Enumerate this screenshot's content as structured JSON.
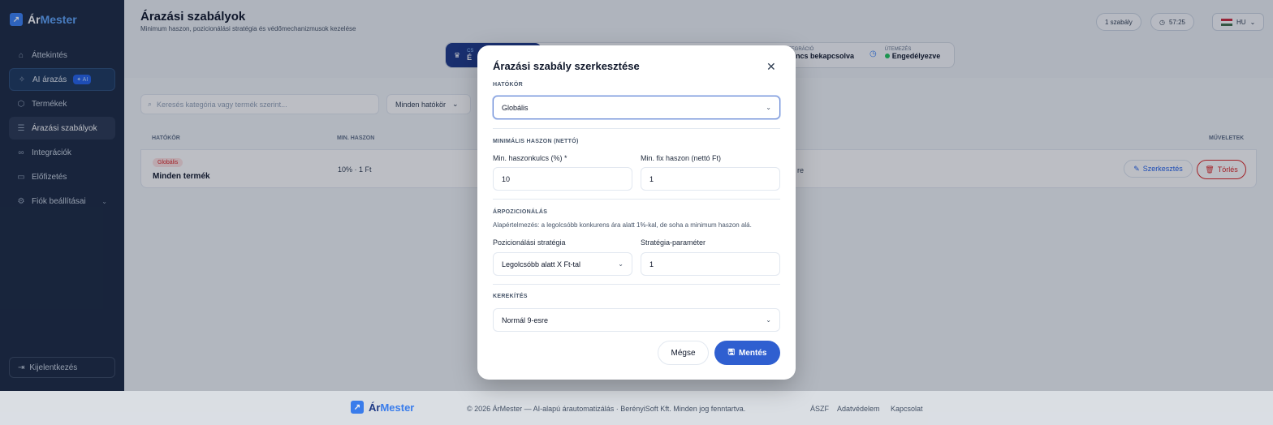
{
  "app": {
    "logo_prefix": "Ár",
    "logo_suffix": "Mester"
  },
  "sidebar": {
    "items": [
      {
        "label": "Áttekintés",
        "icon": "home-icon"
      },
      {
        "label": "AI árazás",
        "icon": "sparkle-icon",
        "badge": "✦ AI"
      },
      {
        "label": "Termékek",
        "icon": "box-icon"
      },
      {
        "label": "Árazási szabályok",
        "icon": "sliders-icon"
      },
      {
        "label": "Integrációk",
        "icon": "link-icon"
      },
      {
        "label": "Előfizetés",
        "icon": "card-icon"
      },
      {
        "label": "Fiók beállításai",
        "icon": "gear-icon"
      }
    ],
    "logout": "Kijelentkezés"
  },
  "header": {
    "title": "Árazási szabályok",
    "subtitle": "Minimum haszon, pozicionálási stratégia és védőmechanizmusok kezelése",
    "rule_count": "1 szabály",
    "timer": "57:25",
    "language": "HU"
  },
  "status": {
    "plan_small": "CS",
    "plan_big": "É",
    "integration_label": "TEGRÁCIÓ",
    "integration_value": "Nincs bekapcsolva",
    "schedule_label": "ÜTEMEZÉS",
    "schedule_value": "Engedélyezve"
  },
  "filters": {
    "search_placeholder": "Keresés kategória vagy termék szerint...",
    "scope": "Minden hatókör"
  },
  "table": {
    "headers": {
      "scope": "HATÓKÖR",
      "margin": "MIN. HASZON",
      "actions": "MŰVELETEK"
    },
    "row": {
      "badge": "Globális",
      "name": "Minden termék",
      "margin": "10% · 1 Ft",
      "rounding_tail": "re",
      "edit": "Szerkesztés",
      "delete": "Törlés"
    }
  },
  "modal": {
    "title": "Árazási szabály szerkesztése",
    "scope_label": "HATÓKÖR",
    "scope_value": "Globális",
    "margin_section": "MINIMÁLIS HASZON (NETTÓ)",
    "margin_pct_label": "Min. haszonkulcs (%) *",
    "margin_pct_value": "10",
    "margin_fix_label": "Min. fix haszon (nettó Ft)",
    "margin_fix_value": "1",
    "pos_section": "ÁRPOZICIONÁLÁS",
    "pos_hint": "Alapértelmezés: a legolcsóbb konkurens ára alatt 1%-kal, de soha a minimum haszon alá.",
    "strategy_label": "Pozicionálási stratégia",
    "strategy_value": "Legolcsóbb alatt X Ft-tal",
    "param_label": "Stratégia-paraméter",
    "param_value": "1",
    "rounding_section": "KEREKÍTÉS",
    "rounding_value": "Normál 9-esre",
    "cancel": "Mégse",
    "save": "Mentés"
  },
  "footer": {
    "copyright": "© 2026 ÁrMester — AI-alapú árautomatizálás · BerényiSoft Kft. Minden jog fenntartva.",
    "links": [
      "ÁSZF",
      "Adatvédelem",
      "Kapcsolat"
    ]
  }
}
